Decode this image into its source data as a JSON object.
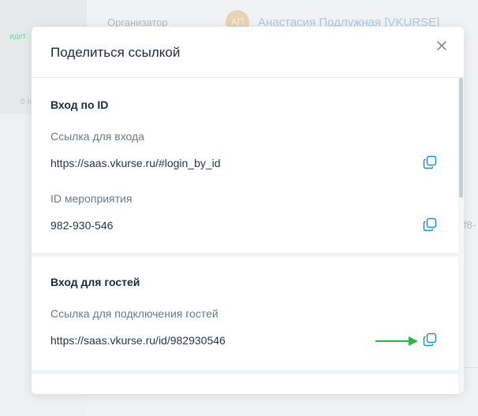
{
  "background": {
    "status_badge": "идет",
    "count_snip": "0 п",
    "organizer_label": "Организатор",
    "avatar_initials": "АП",
    "organizer_name": "Анастасия Подлужная [VKURSE]",
    "id_snip": "f8-"
  },
  "modal": {
    "title": "Поделиться ссылкой",
    "close_icon": "close-icon",
    "sections": [
      {
        "title": "Вход по ID",
        "fields": [
          {
            "label": "Ссылка для входа",
            "value": "https://saas.vkurse.ru/#login_by_id",
            "action_icon": "copy-icon"
          },
          {
            "label": "ID мероприятия",
            "value": "982-930-546",
            "action_icon": "copy-icon"
          }
        ]
      },
      {
        "title": "Вход для гостей",
        "fields": [
          {
            "label": "Ссылка для подключения гостей",
            "value": "https://saas.vkurse.ru/id/982930546",
            "action_icon": "copy-icon"
          }
        ]
      }
    ]
  },
  "colors": {
    "accent": "#1a8fd1",
    "annotation_arrow": "#2db34a"
  }
}
